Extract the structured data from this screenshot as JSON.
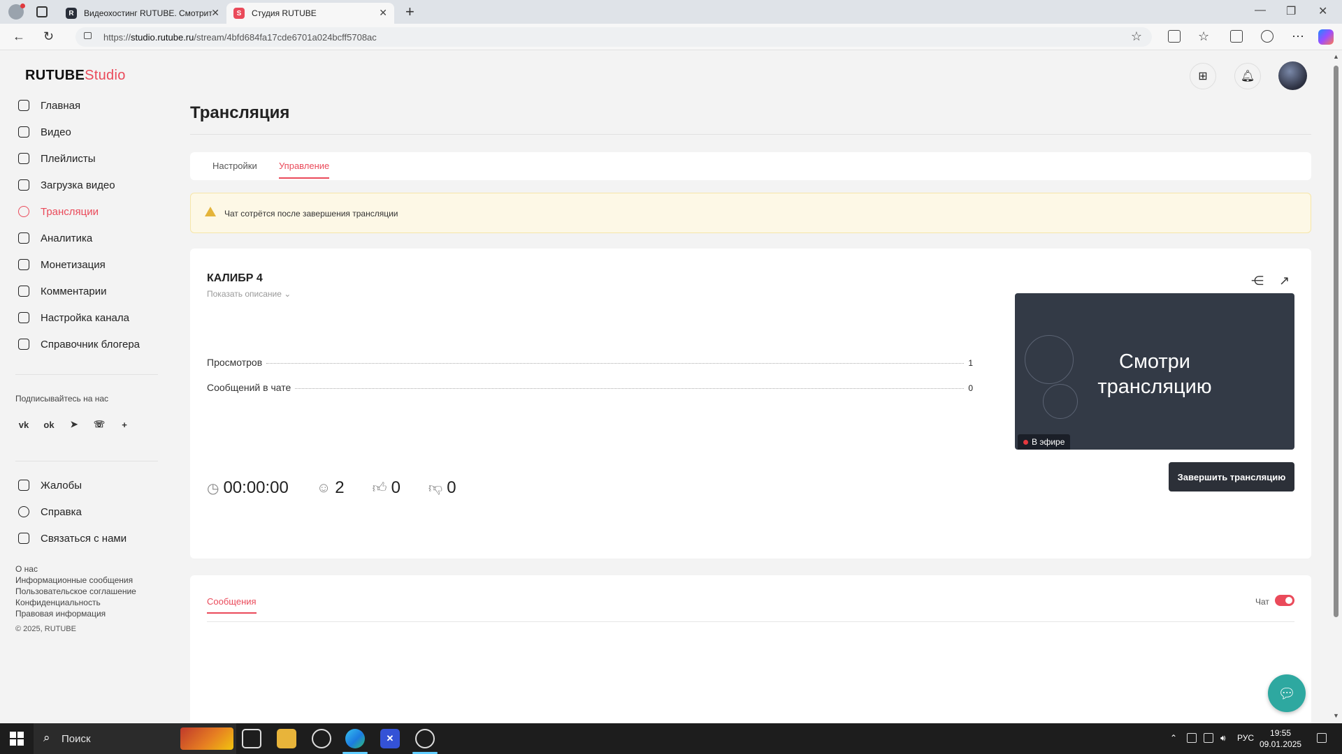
{
  "browser": {
    "tabs": [
      {
        "title": "Видеохостинг RUTUBE. Смотрит",
        "favicon": "R"
      },
      {
        "title": "Студия RUTUBE",
        "favicon": "S"
      }
    ],
    "url_prefix": "https://",
    "url_host": "studio.rutube.ru",
    "url_path": "/stream/4bfd684fa17cde6701a024bcff5708ac"
  },
  "logo": {
    "main": "RUTUBE",
    "suffix": "Studio"
  },
  "sidebar": {
    "items": [
      {
        "label": "Главная",
        "icon": "home-icon"
      },
      {
        "label": "Видео",
        "icon": "video-icon"
      },
      {
        "label": "Плейлисты",
        "icon": "playlist-icon"
      },
      {
        "label": "Загрузка видео",
        "icon": "upload-icon"
      },
      {
        "label": "Трансляции",
        "icon": "broadcast-icon"
      },
      {
        "label": "Аналитика",
        "icon": "analytics-icon"
      },
      {
        "label": "Монетизация",
        "icon": "monetization-icon"
      },
      {
        "label": "Комментарии",
        "icon": "comments-icon"
      },
      {
        "label": "Настройка канала",
        "icon": "settings-icon"
      },
      {
        "label": "Справочник блогера",
        "icon": "handbook-icon"
      }
    ],
    "active_index": 4,
    "subscribe_label": "Подписывайтесь на нас",
    "bottom_items": [
      {
        "label": "Жалобы",
        "icon": "flag-icon"
      },
      {
        "label": "Справка",
        "icon": "help-icon"
      },
      {
        "label": "Связаться с нами",
        "icon": "mail-icon"
      }
    ],
    "footer_links": [
      "О нас",
      "Информационные сообщения",
      "Пользовательское соглашение",
      "Конфиденциальность",
      "Правовая информация"
    ],
    "copyright": "© 2025, RUTUBE"
  },
  "page": {
    "title": "Трансляция",
    "tabs": [
      "Настройки",
      "Управление"
    ],
    "active_tab": 1,
    "alert": "Чат сотрётся после завершения трансляции"
  },
  "stream": {
    "title": "КАЛИБР 4",
    "show_description": "Показать описание",
    "stats": [
      {
        "label": "Просмотров",
        "value": "1"
      },
      {
        "label": "Сообщений в чате",
        "value": "0"
      }
    ],
    "preview_text_line1": "Смотри",
    "preview_text_line2": "трансляцию",
    "live_label": "В эфире",
    "duration": "00:00:00",
    "viewers": "2",
    "likes": "0",
    "dislikes": "0",
    "end_button": "Завершить трансляцию"
  },
  "chat": {
    "tab": "Сообщения",
    "toggle_label": "Чат",
    "enabled": true
  },
  "taskbar": {
    "search": "Поиск",
    "lang": "РУС",
    "time": "19:55",
    "date": "09.01.2025"
  },
  "colors": {
    "accent": "#ea4a5a",
    "dark_button": "#2c3038",
    "alert_bg": "#fdf8e6"
  }
}
